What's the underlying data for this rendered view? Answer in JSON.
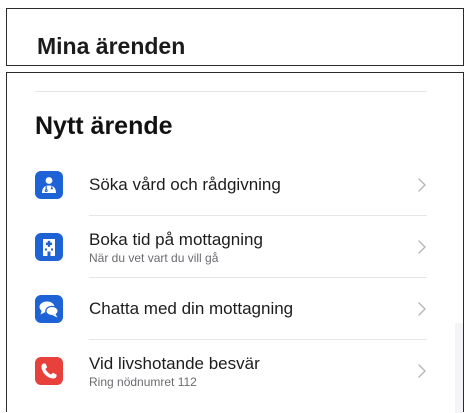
{
  "header": {
    "title": "Mina ärenden"
  },
  "section": {
    "title": "Nytt ärende"
  },
  "items": [
    {
      "label": "Söka vård och rådgivning",
      "sub": "",
      "icon": "doctor-icon",
      "color": "#1E63D6"
    },
    {
      "label": "Boka tid på mottagning",
      "sub": "När du vet vart du vill gå",
      "icon": "clinic-building-icon",
      "color": "#1E63D6"
    },
    {
      "label": "Chatta med din mottagning",
      "sub": "",
      "icon": "chat-bubbles-icon",
      "color": "#1E63D6"
    },
    {
      "label": "Vid livshotande besvär",
      "sub": "Ring nödnumret 112",
      "icon": "phone-icon",
      "color": "#E8403A"
    }
  ],
  "colors": {
    "accent_blue": "#1E63D6",
    "emergency_red": "#E8403A",
    "chevron": "#B5B5BA"
  }
}
